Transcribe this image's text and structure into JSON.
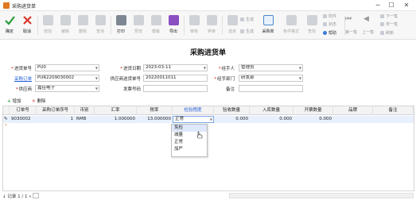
{
  "window": {
    "title": "采购进货单",
    "controls": {
      "minimize": "─",
      "maximize": "☐",
      "close": "✕"
    }
  },
  "toolbar": {
    "buttons": [
      {
        "label": "确定",
        "icon": "check-icon",
        "enabled": true,
        "color": "#2a9a3a"
      },
      {
        "label": "取消",
        "icon": "close-icon",
        "enabled": true,
        "color": "#d9342b"
      },
      {
        "label": "增加",
        "icon": "add-doc-icon",
        "enabled": false
      },
      {
        "label": "编辑",
        "icon": "edit-doc-icon",
        "enabled": false
      },
      {
        "label": "删除",
        "icon": "delete-doc-icon",
        "enabled": false
      },
      {
        "label": "查询",
        "icon": "search-doc-icon",
        "enabled": false
      },
      {
        "label": "打印",
        "icon": "printer-icon",
        "enabled": true,
        "dropdown": true
      },
      {
        "label": "预览",
        "icon": "preview-icon",
        "enabled": false
      },
      {
        "label": "模板",
        "icon": "template-icon",
        "enabled": false
      },
      {
        "label": "导出",
        "icon": "export-icon",
        "enabled": true,
        "dropdown": true
      },
      {
        "label": "审核",
        "icon": "audit-icon",
        "enabled": false
      },
      {
        "label": "弃审",
        "icon": "unaudit-icon",
        "enabled": false
      },
      {
        "label": "选单",
        "icon": "select-doc-icon",
        "enabled": false,
        "dropdown": true
      },
      {
        "label": "采购单",
        "icon": "purchase-order-icon",
        "enabled": true
      },
      {
        "label": "条件格式",
        "icon": "conditional-format-icon",
        "enabled": false
      },
      {
        "label": "查找",
        "icon": "binoculars-icon",
        "enabled": false
      }
    ],
    "small": {
      "copy1": "生成",
      "copy2": "生成",
      "attach": "附件",
      "status": "状态",
      "help": "帮助",
      "first": "第一笔",
      "prev": "上一笔",
      "next": "下一笔",
      "last": "末一笔",
      "refresh": "刷新"
    }
  },
  "form": {
    "title": "采购进货单",
    "fields": {
      "doc_no_label": "进货单号",
      "doc_no": "PU0",
      "date_label": "进货日期",
      "date": "2023-03-11",
      "handler_label": "经手人",
      "handler": "管理员",
      "po_label": "采购订单",
      "po": "PUR2209030002",
      "supplier_ship_label": "供应商送货单号",
      "supplier_ship": "20220011011",
      "dept_label": "经手部门",
      "dept": "研发部",
      "supplier_label": "供应商",
      "supplier": "嘉佳电子",
      "invoice_label": "发票号码",
      "invoice": "",
      "remark_label": "备注",
      "remark": ""
    }
  },
  "grid_toolbar": {
    "add": "增加",
    "delete": "删除"
  },
  "grid": {
    "columns": [
      "订单号",
      "采购订单序号",
      "币别",
      "汇率",
      "税率",
      "检验程度",
      "验收数量",
      "入库数量",
      "开票数量",
      "品牌",
      "备注"
    ],
    "rows": [
      {
        "order_no": "9030002",
        "seq": "1",
        "currency": "RMB",
        "rate": "1.000000",
        "tax": "13.000000",
        "inspection": "正常",
        "accept_qty": "0.000",
        "stock_qty": "0.000",
        "invoice_qty": "0.000",
        "brand": "",
        "remark": ""
      }
    ],
    "new_row_marker": "*"
  },
  "inspection_dropdown": {
    "options": [
      "免检",
      "减量",
      "正常",
      "加严"
    ],
    "highlighted": "免检"
  },
  "status_bar": {
    "record_text": "记录 1 / 1"
  }
}
